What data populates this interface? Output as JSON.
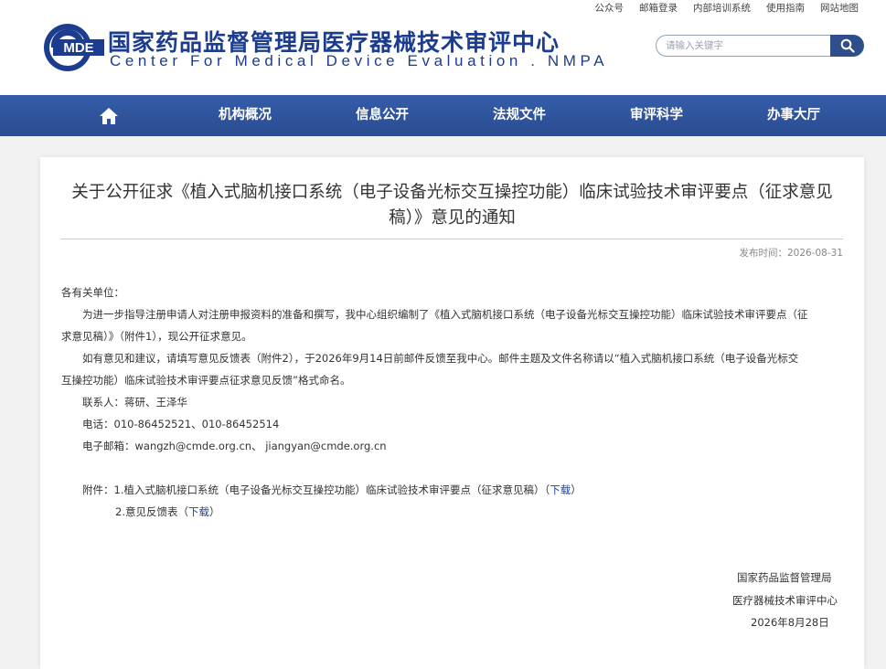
{
  "toplinks": [
    "公众号",
    "邮箱登录",
    "内部培训系统",
    "使用指南",
    "网站地图"
  ],
  "logo": {
    "text": "MDE"
  },
  "site": {
    "title_cn": "国家药品监督管理局医疗器械技术审评中心",
    "title_en": "Center For Medical Device Evaluation . NMPA"
  },
  "search": {
    "placeholder": "请输入关键字"
  },
  "nav": {
    "items": [
      "机构概况",
      "信息公开",
      "法规文件",
      "审评科学",
      "办事大厅"
    ]
  },
  "article": {
    "title": "关于公开征求《植入式脑机接口系统（电子设备光标交互操控功能）临床试验技术审评要点（征求意见稿）》意见的通知",
    "pubdate": "发布时间：2026-08-31",
    "greeting": "各有关单位：",
    "para1_line1": "为进一步指导注册申请人对注册申报资料的准备和撰写，我中心组织编制了《植入式脑机接口系统（电子设备光标交互操控功能）临床试验技术审评要点（征",
    "para1_line2": "求意见稿）》（附件1），现公开征求意见。",
    "para2_line1": "如有意见和建议，请填写意见反馈表（附件2），于2026年9月14日前邮件反馈至我中心。邮件主题及文件名称请以“植入式脑机接口系统（电子设备光标交",
    "para2_line2": "互操控功能）临床试验技术审评要点征求意见反馈”格式命名。",
    "contact": "联系人：蒋研、王泽华",
    "phone": "电话：010-86452521、010-86452514",
    "email": "电子邮箱：wangzh@cmde.org.cn、 jiangyan@cmde.org.cn",
    "attach1_prefix": "附件：1.植入式脑机接口系统（电子设备光标交互操控功能）临床试验技术审评要点（征求意见稿）（",
    "attach2_prefix": "2.意见反馈表（",
    "download_label": "下载",
    "paren_close": "）",
    "sign_org1": "国家药品监督管理局",
    "sign_org2": "医疗器械技术审评中心",
    "sign_date": "2026年8月28日"
  },
  "colors": {
    "brand": "#1c3d8f",
    "nav": "#2f55a0",
    "link": "#1a3fb0"
  }
}
